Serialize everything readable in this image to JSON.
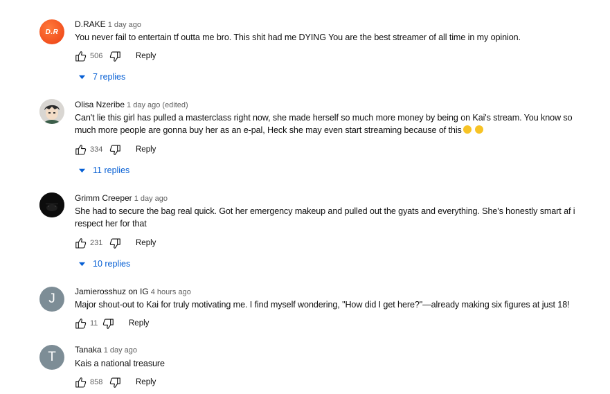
{
  "comments": [
    {
      "author": "D.RAKE",
      "time": "1 day ago",
      "avatar": {
        "type": "initials",
        "text": "D.R",
        "color": "#f2501e"
      },
      "text": "You never fail to entertain tf outta me bro. This shit had me DYING You are the best streamer of all time in my opinion.",
      "likes": "506",
      "reply_label": "Reply",
      "replies_label": "7 replies"
    },
    {
      "author": "Olisa Nzeribe",
      "time": "1 day ago (edited)",
      "avatar": {
        "type": "image",
        "icon": "anime-character-avatar"
      },
      "text": "Can't lie this girl has pulled a masterclass right now, she made herself so much more money by being on Kai's stream. You know so much more people are gonna buy her as an e-pal, Heck she may even start streaming because of this",
      "emoji": [
        "rolling-on-floor-laughing-emoji",
        "rolling-on-floor-laughing-emoji"
      ],
      "likes": "334",
      "reply_label": "Reply",
      "replies_label": "11 replies"
    },
    {
      "author": "Grimm Creeper",
      "time": "1 day ago",
      "avatar": {
        "type": "image",
        "icon": "dark-avatar"
      },
      "text": "She had to secure the bag real quick. Got her emergency makeup and pulled out the gyats and everything. She's honestly smart af i respect her for that",
      "likes": "231",
      "reply_label": "Reply",
      "replies_label": "10 replies"
    },
    {
      "author": "Jamierosshuz on IG",
      "time": "4 hours ago",
      "avatar": {
        "type": "letter",
        "text": "J",
        "color": "#7d8d96"
      },
      "text": "Major shout-out to Kai for truly motivating me.  I find myself wondering, \"How did I get here?\"—already making six figures at just 18!",
      "likes": "11",
      "reply_label": "Reply"
    },
    {
      "author": "Tanaka",
      "time": "1 day ago",
      "avatar": {
        "type": "letter",
        "text": "T",
        "color": "#7d8d96"
      },
      "text": "Kais a national treasure",
      "likes": "858",
      "reply_label": "Reply"
    }
  ],
  "colors": {
    "link_blue": "#065fd4",
    "secondary_text": "#606060",
    "primary_text": "#0f0f0f"
  }
}
